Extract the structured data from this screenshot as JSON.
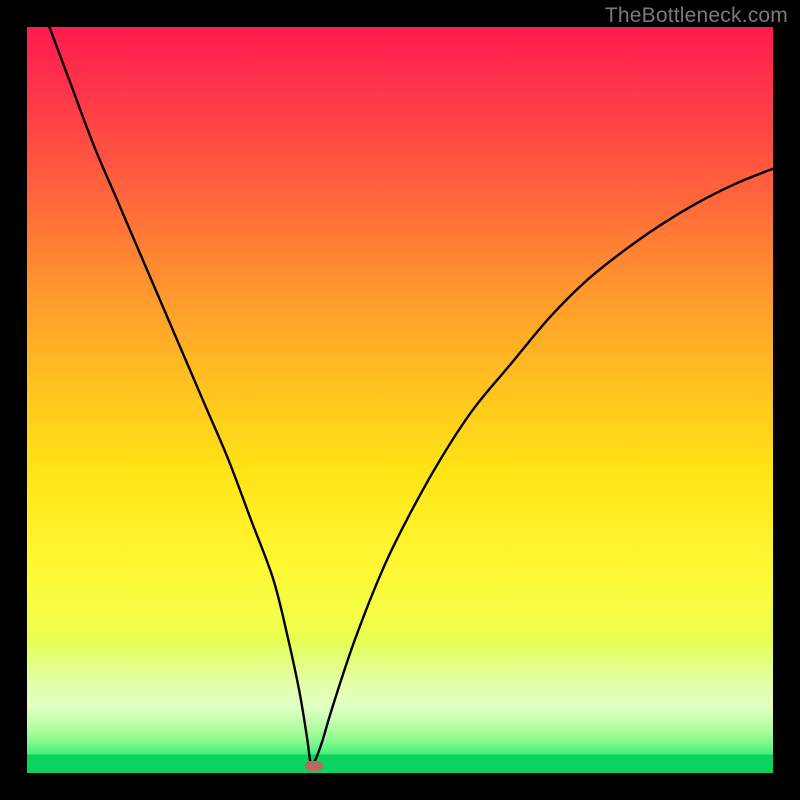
{
  "watermark": "TheBottleneck.com",
  "colors": {
    "frame": "#000000",
    "curve": "#000000",
    "marker": "#b66b60",
    "gradient_top": "#ff1a4f",
    "gradient_bottom": "#0bd35e"
  },
  "chart_data": {
    "type": "line",
    "title": "",
    "xlabel": "",
    "ylabel": "",
    "xlim": [
      0,
      100
    ],
    "ylim": [
      0,
      100
    ],
    "notch_x": 38,
    "marker": {
      "x": 38.5,
      "y": 1
    },
    "series": [
      {
        "name": "bottleneck-curve",
        "x": [
          3,
          6,
          9,
          12,
          15,
          18,
          21,
          24,
          27,
          30,
          33,
          35,
          36.5,
          37.5,
          38,
          38.5,
          39.5,
          41,
          44,
          48,
          52,
          56,
          60,
          65,
          70,
          75,
          80,
          85,
          90,
          95,
          100
        ],
        "y": [
          100,
          92,
          84,
          77,
          70,
          63,
          56,
          49,
          42,
          34,
          26,
          18,
          11,
          5,
          1.5,
          1.5,
          4,
          9,
          18,
          28,
          36,
          43,
          49,
          55,
          61,
          66,
          70,
          73.5,
          76.5,
          79,
          81
        ]
      }
    ]
  }
}
